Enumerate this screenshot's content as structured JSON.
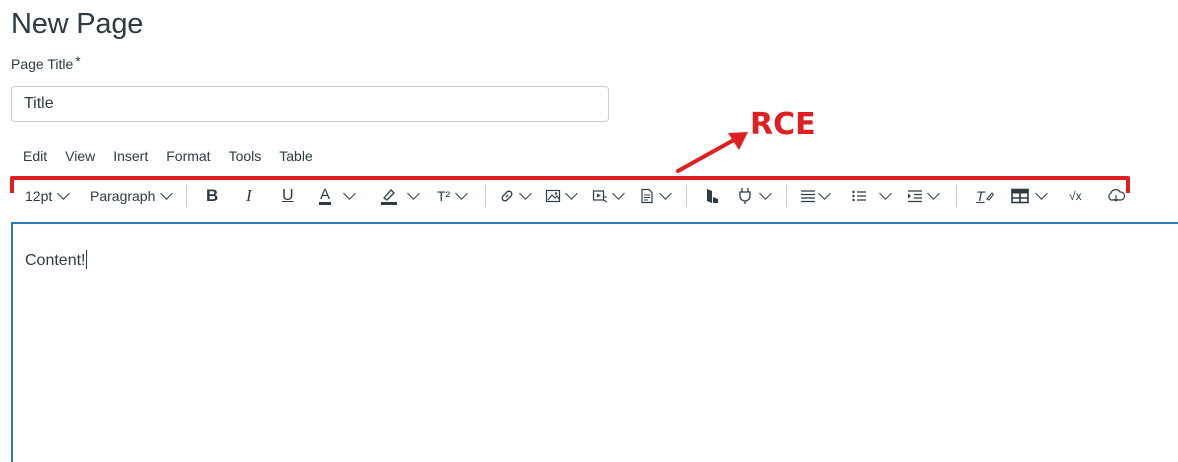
{
  "page": {
    "title": "New Page"
  },
  "title_field": {
    "label": "Page Title",
    "required_marker": "*",
    "placeholder": "Title"
  },
  "menubar": [
    "Edit",
    "View",
    "Insert",
    "Format",
    "Tools",
    "Table"
  ],
  "toolbar": {
    "font_size": "12pt",
    "block_format": "Paragraph",
    "bold_glyph": "B",
    "italic_glyph": "I",
    "underline_glyph": "U",
    "text_color_glyph": "A",
    "superscript_glyph": "T²",
    "clear_format_glyph": "T",
    "math_glyph": "√x",
    "icons": [
      "bold-icon",
      "italic-icon",
      "underline-icon",
      "text-color-icon",
      "highlight-icon",
      "superscript-icon",
      "link-icon",
      "image-icon",
      "media-icon",
      "document-icon",
      "apps-icon",
      "plugin-icon",
      "align-icon",
      "bullet-list-icon",
      "indent-icon",
      "clear-formatting-icon",
      "table-icon",
      "math-icon",
      "cloud-icon"
    ]
  },
  "editor": {
    "content": "Content!"
  },
  "annotation": {
    "label": "RCE",
    "color": "#e02020"
  },
  "colors": {
    "text": "#2d3b45",
    "focus_border": "#2b7abc",
    "separator": "#c7cdd1"
  }
}
